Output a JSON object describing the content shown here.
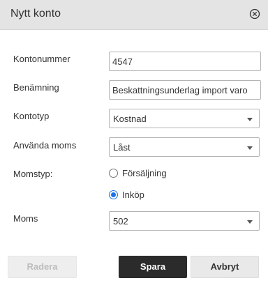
{
  "dialog": {
    "title": "Nytt konto",
    "close_icon": "close-circle-icon"
  },
  "form": {
    "kontonummer": {
      "label": "Kontonummer",
      "value": "4547"
    },
    "benamning": {
      "label": "Benämning",
      "value": "Beskattningsunderlag import varo"
    },
    "kontotyp": {
      "label": "Kontotyp",
      "value": "Kostnad"
    },
    "anvanda_moms": {
      "label": "Använda moms",
      "value": "Låst"
    },
    "momstyp": {
      "label": "Momstyp:",
      "options": [
        {
          "label": "Försäljning",
          "selected": false
        },
        {
          "label": "Inköp",
          "selected": true
        }
      ]
    },
    "moms": {
      "label": "Moms",
      "value": "502"
    }
  },
  "buttons": {
    "delete": "Radera",
    "save": "Spara",
    "cancel": "Avbryt"
  },
  "colors": {
    "header_bg": "#e4e4e4",
    "primary_button": "#2b2b2b",
    "radio_accent": "#1a73e8"
  }
}
